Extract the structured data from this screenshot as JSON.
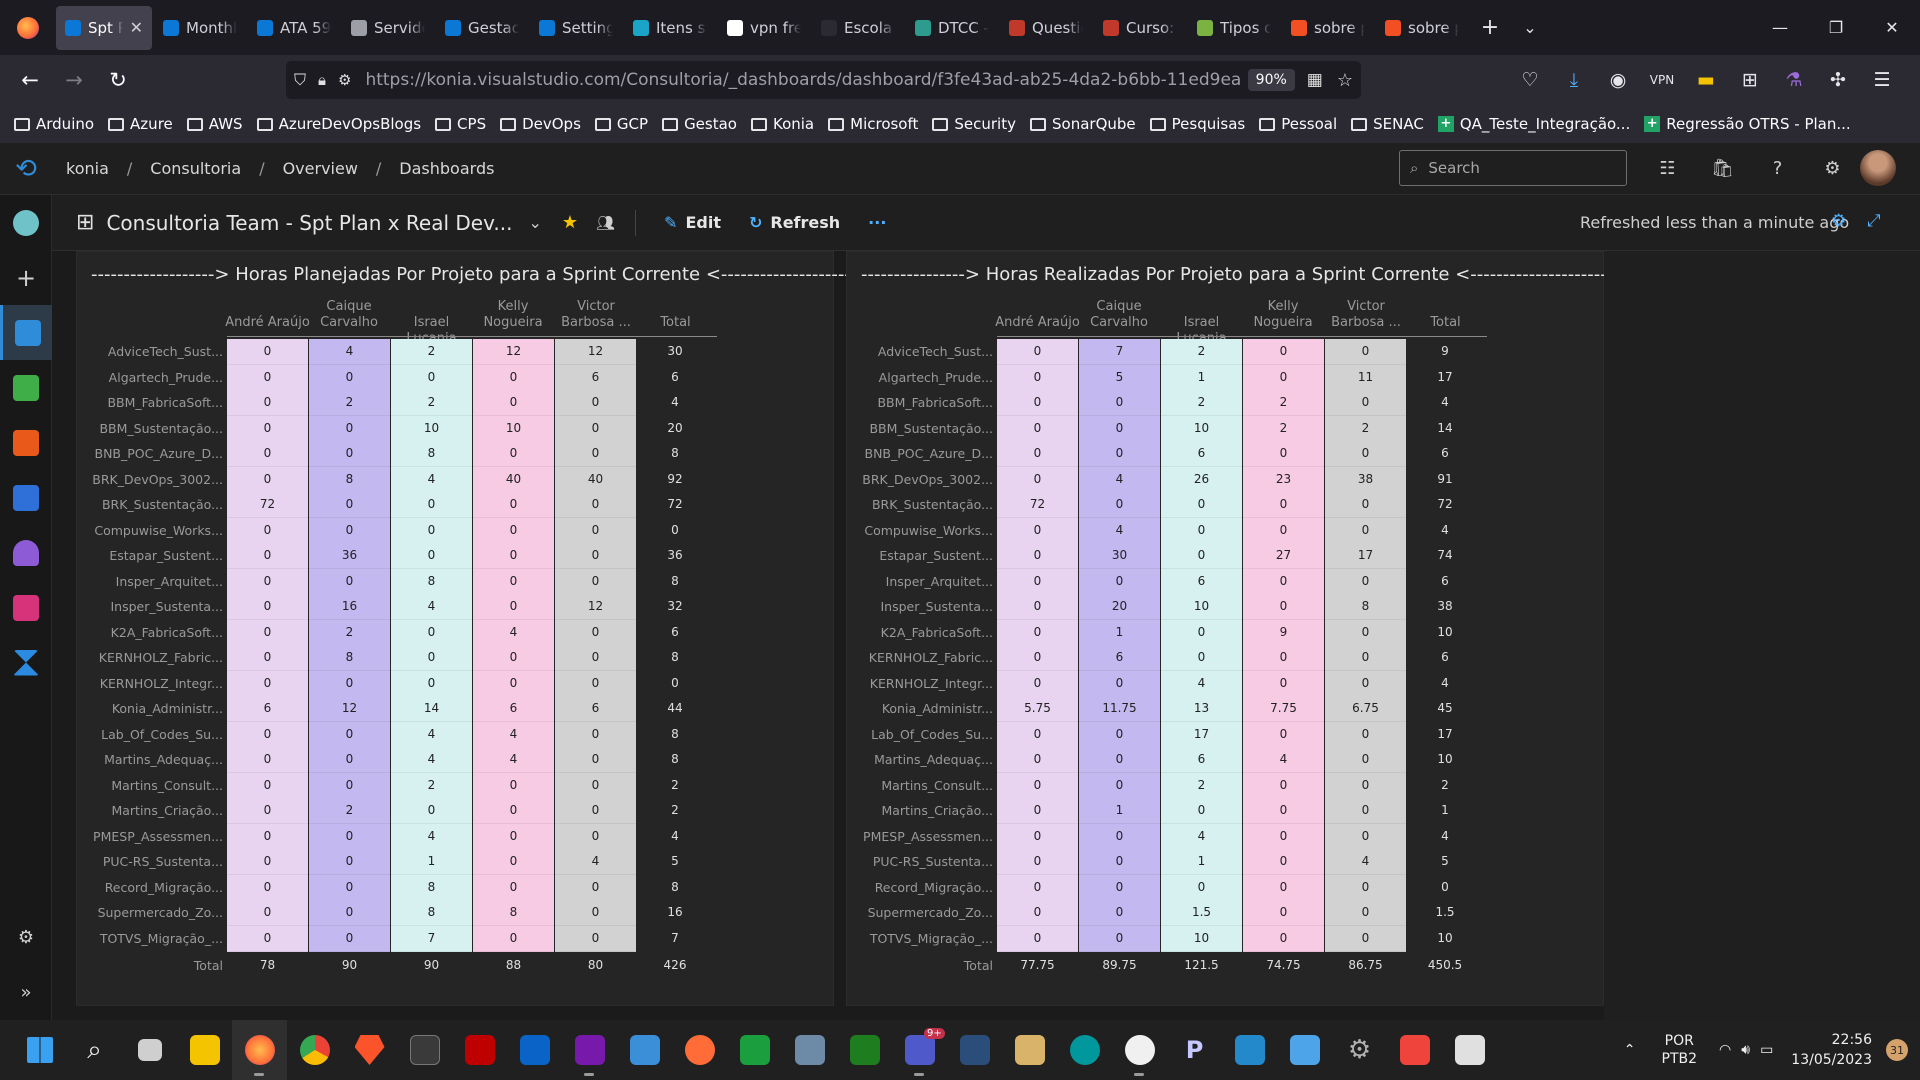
{
  "browser": {
    "tabs": [
      {
        "label": "Spt P",
        "color": "#0a78d4",
        "active": true
      },
      {
        "label": "Monthl",
        "color": "#0a78d4"
      },
      {
        "label": "ATA 59",
        "color": "#0a78d4"
      },
      {
        "label": "Servido",
        "color": "#9e9ea6"
      },
      {
        "label": "Gestao",
        "color": "#0a78d4"
      },
      {
        "label": "Setting",
        "color": "#0a78d4"
      },
      {
        "label": "Itens so",
        "color": "#1aa4c8"
      },
      {
        "label": "vpn free",
        "color": "#ffffff"
      },
      {
        "label": "Escola t",
        "color": "#2b2a33"
      },
      {
        "label": "DTCC -",
        "color": "#2e9b8f"
      },
      {
        "label": "Questic",
        "color": "#c0392b"
      },
      {
        "label": "Curso: T",
        "color": "#c0392b"
      },
      {
        "label": "Tipos d",
        "color": "#7bb342"
      },
      {
        "label": "sobre p",
        "color": "#f25022"
      },
      {
        "label": "sobre p",
        "color": "#f25022"
      }
    ],
    "url": "https://konia.visualstudio.com/Consultoria/_dashboards/dashboard/f3fe43ad-ab25-4da2-b6bb-11ed9ea2109",
    "zoom": "90%",
    "bookmarks": [
      "Arduino",
      "Azure",
      "AWS",
      "AzureDevOpsBlogs",
      "CPS",
      "DevOps",
      "GCP",
      "Gestao",
      "Konia",
      "Microsoft",
      "Security",
      "SonarQube",
      "Pesquisas",
      "Pessoal",
      "SENAC"
    ],
    "sheet_bookmarks": [
      "QA_Teste_Integração...",
      "Regressão OTRS - Plan..."
    ]
  },
  "ado": {
    "breadcrumb": [
      "konia",
      "Consultoria",
      "Overview",
      "Dashboards"
    ],
    "search_placeholder": "Search",
    "dashboard_title": "Consultoria Team - Spt Plan x Real Dev...",
    "edit_label": "Edit",
    "refresh_label": "Refresh",
    "more_label": "···",
    "status": "Refreshed less than a minute ago"
  },
  "columns": [
    "André Araújo",
    "Caique Carvalho",
    "Israel Lucania",
    "Kelly Nogueira",
    "Victor Barbosa ...",
    "Total"
  ],
  "column_colors": [
    "#e8d4f0",
    "#c3b8ef",
    "#d7f0f0",
    "#f7cbe4",
    "#d2d2d2"
  ],
  "total_label": "Total",
  "rows": [
    "AdviceTech_Sust...",
    "Algartech_Prude...",
    "BBM_FabricaSoft...",
    "BBM_Sustentação...",
    "BNB_POC_Azure_D...",
    "BRK_DevOps_3002...",
    "BRK_Sustentação...",
    "Compuwise_Works...",
    "Estapar_Sustent...",
    "Insper_Arquitet...",
    "Insper_Sustenta...",
    "K2A_FabricaSoft...",
    "KERNHOLZ_Fabric...",
    "KERNHOLZ_Integr...",
    "Konia_Administr...",
    "Lab_Of_Codes_Su...",
    "Martins_Adequaç...",
    "Martins_Consult...",
    "Martins_Criação...",
    "PMESP_Assessmen...",
    "PUC-RS_Sustenta...",
    "Record_Migração...",
    "Supermercado_Zo...",
    "TOTVS_Migração_..."
  ],
  "planned": {
    "title": "-------------------> Horas Planejadas Por Projeto para a Sprint Corrente <--------------------",
    "values": [
      [
        "0",
        "4",
        "2",
        "12",
        "12",
        "30"
      ],
      [
        "0",
        "0",
        "0",
        "0",
        "6",
        "6"
      ],
      [
        "0",
        "2",
        "2",
        "0",
        "0",
        "4"
      ],
      [
        "0",
        "0",
        "10",
        "10",
        "0",
        "20"
      ],
      [
        "0",
        "0",
        "8",
        "0",
        "0",
        "8"
      ],
      [
        "0",
        "8",
        "4",
        "40",
        "40",
        "92"
      ],
      [
        "72",
        "0",
        "0",
        "0",
        "0",
        "72"
      ],
      [
        "0",
        "0",
        "0",
        "0",
        "0",
        "0"
      ],
      [
        "0",
        "36",
        "0",
        "0",
        "0",
        "36"
      ],
      [
        "0",
        "0",
        "8",
        "0",
        "0",
        "8"
      ],
      [
        "0",
        "16",
        "4",
        "0",
        "12",
        "32"
      ],
      [
        "0",
        "2",
        "0",
        "4",
        "0",
        "6"
      ],
      [
        "0",
        "8",
        "0",
        "0",
        "0",
        "8"
      ],
      [
        "0",
        "0",
        "0",
        "0",
        "0",
        "0"
      ],
      [
        "6",
        "12",
        "14",
        "6",
        "6",
        "44"
      ],
      [
        "0",
        "0",
        "4",
        "4",
        "0",
        "8"
      ],
      [
        "0",
        "0",
        "4",
        "4",
        "0",
        "8"
      ],
      [
        "0",
        "0",
        "2",
        "0",
        "0",
        "2"
      ],
      [
        "0",
        "2",
        "0",
        "0",
        "0",
        "2"
      ],
      [
        "0",
        "0",
        "4",
        "0",
        "0",
        "4"
      ],
      [
        "0",
        "0",
        "1",
        "0",
        "4",
        "5"
      ],
      [
        "0",
        "0",
        "8",
        "0",
        "0",
        "8"
      ],
      [
        "0",
        "0",
        "8",
        "8",
        "0",
        "16"
      ],
      [
        "0",
        "0",
        "7",
        "0",
        "0",
        "7"
      ]
    ],
    "totals": [
      "78",
      "90",
      "90",
      "88",
      "80",
      "426"
    ]
  },
  "realized": {
    "title": "----------------> Horas Realizadas Por Projeto para a Sprint Corrente <----------------------",
    "values": [
      [
        "0",
        "7",
        "2",
        "0",
        "0",
        "9"
      ],
      [
        "0",
        "5",
        "1",
        "0",
        "11",
        "17"
      ],
      [
        "0",
        "0",
        "2",
        "2",
        "0",
        "4"
      ],
      [
        "0",
        "0",
        "10",
        "2",
        "2",
        "14"
      ],
      [
        "0",
        "0",
        "6",
        "0",
        "0",
        "6"
      ],
      [
        "0",
        "4",
        "26",
        "23",
        "38",
        "91"
      ],
      [
        "72",
        "0",
        "0",
        "0",
        "0",
        "72"
      ],
      [
        "0",
        "4",
        "0",
        "0",
        "0",
        "4"
      ],
      [
        "0",
        "30",
        "0",
        "27",
        "17",
        "74"
      ],
      [
        "0",
        "0",
        "6",
        "0",
        "0",
        "6"
      ],
      [
        "0",
        "20",
        "10",
        "0",
        "8",
        "38"
      ],
      [
        "0",
        "1",
        "0",
        "9",
        "0",
        "10"
      ],
      [
        "0",
        "6",
        "0",
        "0",
        "0",
        "6"
      ],
      [
        "0",
        "0",
        "4",
        "0",
        "0",
        "4"
      ],
      [
        "5.75",
        "11.75",
        "13",
        "7.75",
        "6.75",
        "45"
      ],
      [
        "0",
        "0",
        "17",
        "0",
        "0",
        "17"
      ],
      [
        "0",
        "0",
        "6",
        "4",
        "0",
        "10"
      ],
      [
        "0",
        "0",
        "2",
        "0",
        "0",
        "2"
      ],
      [
        "0",
        "1",
        "0",
        "0",
        "0",
        "1"
      ],
      [
        "0",
        "0",
        "4",
        "0",
        "0",
        "4"
      ],
      [
        "0",
        "0",
        "1",
        "0",
        "4",
        "5"
      ],
      [
        "0",
        "0",
        "0",
        "0",
        "0",
        "0"
      ],
      [
        "0",
        "0",
        "1.5",
        "0",
        "0",
        "1.5"
      ],
      [
        "0",
        "0",
        "10",
        "0",
        "0",
        "10"
      ]
    ],
    "totals": [
      "77.75",
      "89.75",
      "121.5",
      "74.75",
      "86.75",
      "450.5"
    ]
  },
  "taskbar": {
    "language": "POR",
    "layout": "PTB2",
    "time": "22:56",
    "date": "13/05/2023",
    "notification_count": "31",
    "teams_badge": "9+"
  }
}
